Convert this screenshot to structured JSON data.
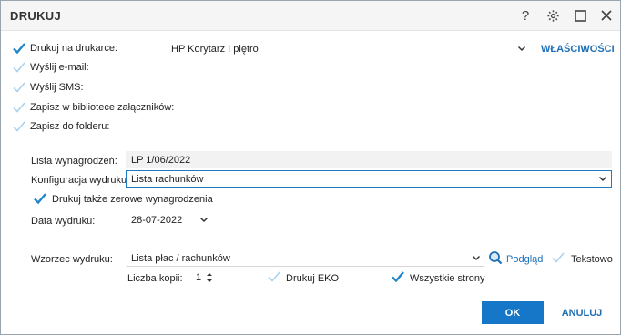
{
  "dialog": {
    "title": "DRUKUJ",
    "help_icon": "?",
    "icons": [
      "help-icon",
      "gear-icon",
      "maximize-icon",
      "close-icon"
    ]
  },
  "outputs": {
    "print_label": "Drukuj na drukarce:",
    "email_label": "Wyślij e-mail:",
    "sms_label": "Wyślij SMS:",
    "library_label": "Zapisz w bibliotece załączników:",
    "folder_label": "Zapisz do folderu:",
    "print_checked": true,
    "email_checked": false,
    "sms_checked": false,
    "library_checked": false,
    "folder_checked": false
  },
  "printer": {
    "value": "HP Korytarz I piętro",
    "properties_label": "WŁAŚCIWOŚCI"
  },
  "payroll": {
    "label": "Lista wynagrodzeń:",
    "value": "LP 1/06/2022"
  },
  "config": {
    "label": "Konfiguracja wydruku:",
    "value": "Lista rachunków"
  },
  "zero_salaries": {
    "label": "Drukuj także zerowe wynagrodzenia",
    "checked": true
  },
  "print_date": {
    "label": "Data wydruku:",
    "value": "28-07-2022"
  },
  "template": {
    "label": "Wzorzec wydruku:",
    "value": "Lista płac / rachunków",
    "preview_label": "Podgląd",
    "text_label": "Tekstowo",
    "text_checked": false
  },
  "copies": {
    "label": "Liczba kopii:",
    "value": "1"
  },
  "eko": {
    "label": "Drukuj EKO",
    "checked": false
  },
  "all_pages": {
    "label": "Wszystkie strony",
    "checked": true
  },
  "buttons": {
    "ok": "OK",
    "cancel": "ANULUJ"
  },
  "colors": {
    "accent": "#1676c8",
    "check_active": "#1f86c9",
    "check_inactive": "#a9d2ee"
  }
}
